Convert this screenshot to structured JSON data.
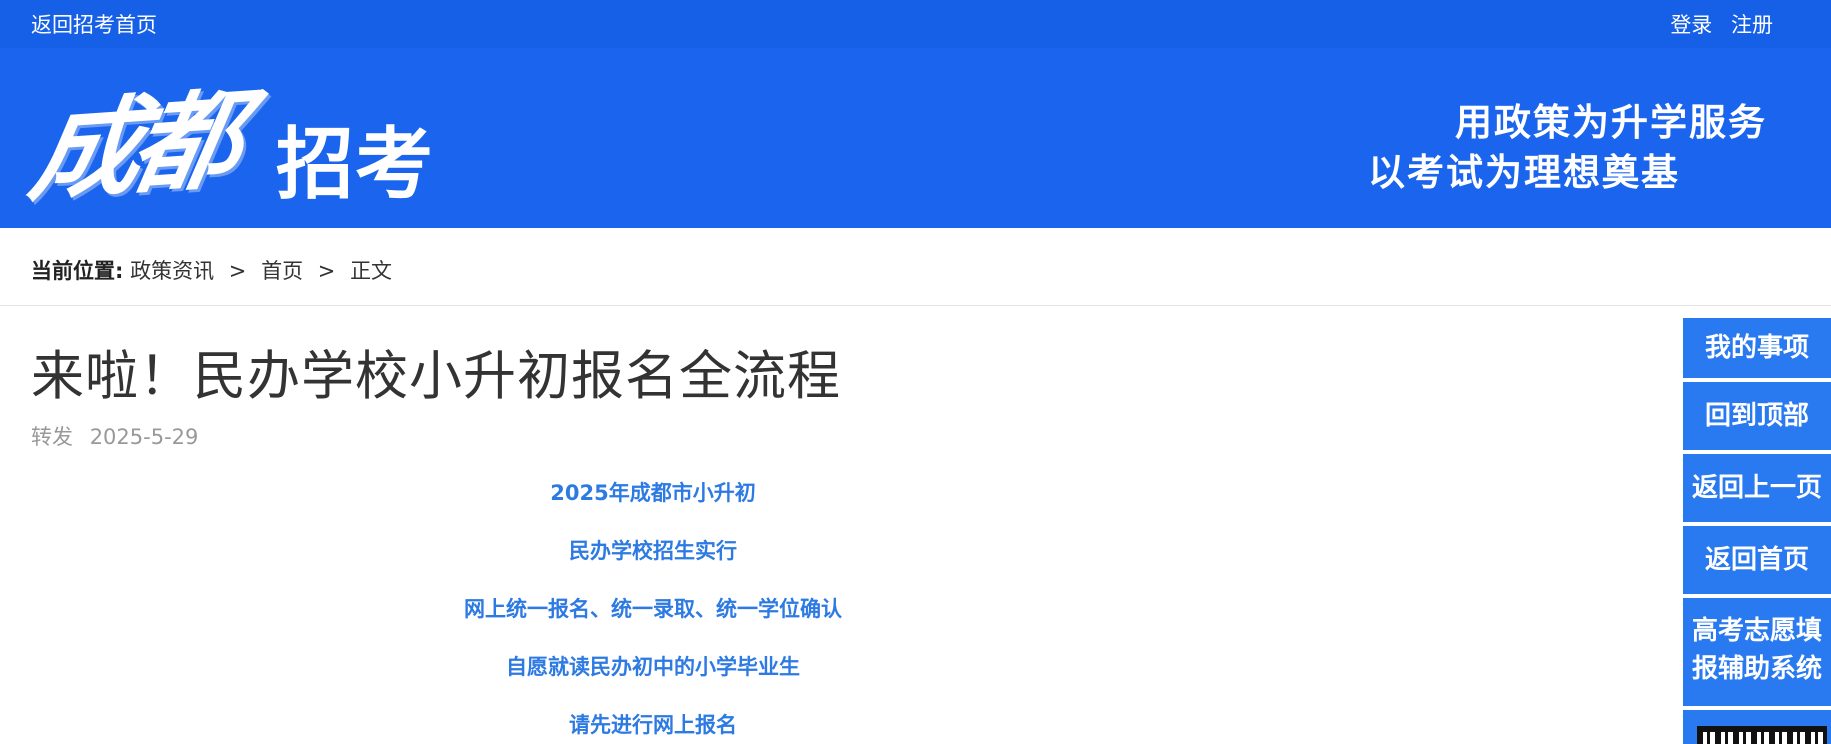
{
  "topbar": {
    "home_link": "返回招考首页",
    "login": "登录",
    "register": "注册"
  },
  "banner": {
    "logo_calligraphy": "成都",
    "logo_text": "招考",
    "slogan_line1": "用政策为升学服务",
    "slogan_line2": "以考试为理想奠基"
  },
  "breadcrumb": {
    "label": "当前位置:",
    "items": [
      "政策资讯",
      "首页",
      "正文"
    ],
    "separator": ">"
  },
  "article": {
    "title": "来啦！民办学校小升初报名全流程",
    "source": "转发",
    "date": "2025-5-29",
    "paragraphs": [
      "2025年成都市小升初",
      "民办学校招生实行",
      "网上统一报名、统一录取、统一学位确认",
      "自愿就读民办初中的小学毕业生",
      "请先进行网上报名"
    ]
  },
  "side_nav": {
    "items": [
      "我的事项",
      "回到顶部",
      "返回上一页",
      "返回首页",
      "高考志愿填报辅助系统"
    ]
  },
  "colors": {
    "topbar": "#1560e6",
    "banner": "#1a64ee",
    "side_button": "#2979f0",
    "content_text": "#2d7ae3"
  }
}
